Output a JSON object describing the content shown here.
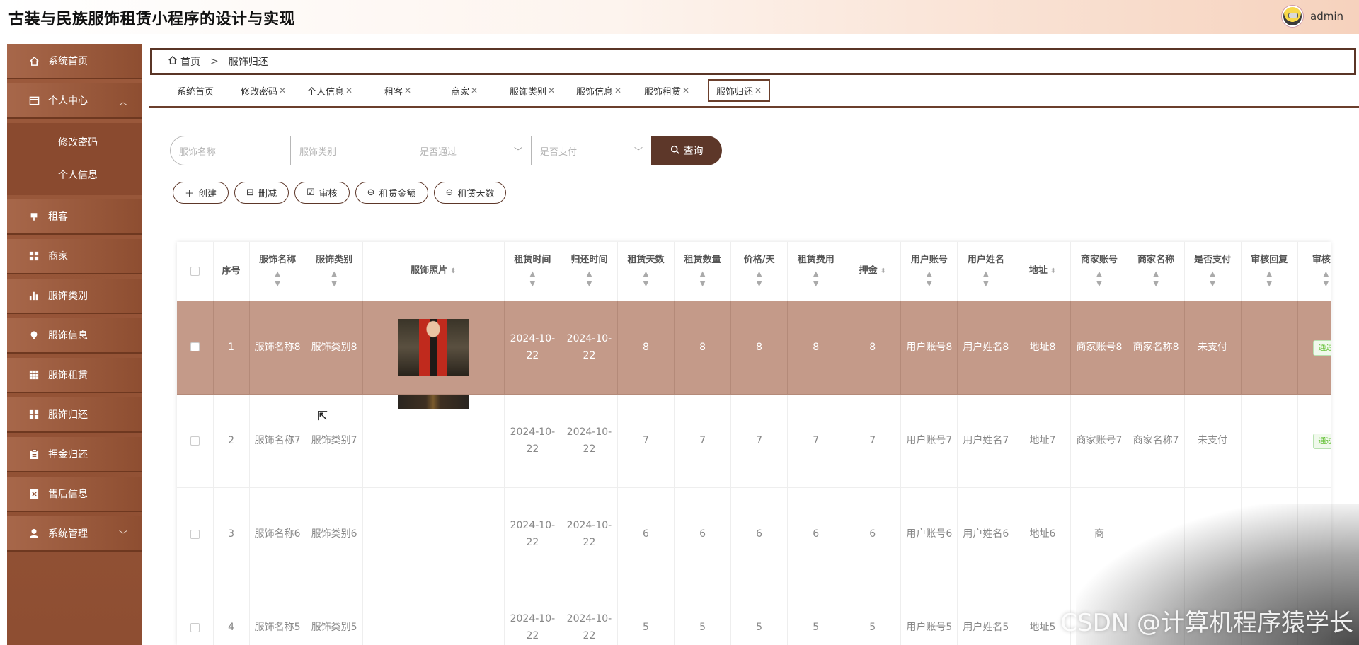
{
  "app": {
    "title": "古装与民族服饰租赁小程序的设计与实现",
    "user": "admin"
  },
  "sidebar": {
    "items": [
      {
        "label": "系统首页",
        "icon": "home-icon"
      },
      {
        "label": "个人中心",
        "icon": "user-card-icon",
        "expanded": true,
        "children": [
          {
            "label": "修改密码"
          },
          {
            "label": "个人信息"
          }
        ]
      },
      {
        "label": "租客",
        "icon": "stamp-icon"
      },
      {
        "label": "商家",
        "icon": "grid-icon"
      },
      {
        "label": "服饰类别",
        "icon": "bar-chart-icon"
      },
      {
        "label": "服饰信息",
        "icon": "bulb-icon"
      },
      {
        "label": "服饰租赁",
        "icon": "table-icon"
      },
      {
        "label": "服饰归还",
        "icon": "grid-icon"
      },
      {
        "label": "押金归还",
        "icon": "clipboard-icon"
      },
      {
        "label": "售后信息",
        "icon": "document-icon"
      },
      {
        "label": "系统管理",
        "icon": "person-icon"
      }
    ]
  },
  "breadcrumb": {
    "home": "首页",
    "separator": ">",
    "current": "服饰归还"
  },
  "tabs": [
    {
      "label": "系统首页",
      "closable": false
    },
    {
      "label": "修改密码",
      "closable": true
    },
    {
      "label": "个人信息",
      "closable": true
    },
    {
      "label": "租客",
      "closable": true
    },
    {
      "label": "商家",
      "closable": true
    },
    {
      "label": "服饰类别",
      "closable": true
    },
    {
      "label": "服饰信息",
      "closable": true
    },
    {
      "label": "服饰租赁",
      "closable": true
    },
    {
      "label": "服饰归还",
      "closable": true,
      "active": true
    }
  ],
  "search": {
    "name_placeholder": "服饰名称",
    "category_placeholder": "服饰类别",
    "passed_placeholder": "是否通过",
    "paid_placeholder": "是否支付",
    "query_label": "查询"
  },
  "actions": {
    "create": "创建",
    "delete": "删减",
    "review": "审核",
    "amount": "租赁金额",
    "days": "租赁天数"
  },
  "table": {
    "headers": {
      "index": "序号",
      "name": "服饰名称",
      "category": "服饰类别",
      "photo": "服饰照片",
      "rent_time": "租赁时间",
      "return_time": "归还时间",
      "rent_days": "租赁天数",
      "rent_qty": "租赁数量",
      "price": "价格/天",
      "rent_fee": "租赁费用",
      "deposit": "押金",
      "user_account": "用户账号",
      "user_name": "用户姓名",
      "address": "地址",
      "merchant_account": "商家账号",
      "merchant_name": "商家名称",
      "paid": "是否支付",
      "review_reply": "审核回复",
      "review_status": "审核状"
    },
    "rows": [
      {
        "index": "1",
        "name": "服饰名称8",
        "category": "服饰类别8",
        "rent_time": "2024-10-22",
        "return_time": "2024-10-22",
        "rent_days": "8",
        "rent_qty": "8",
        "price": "8",
        "rent_fee": "8",
        "deposit": "8",
        "user_account": "用户账号8",
        "user_name": "用户姓名8",
        "address": "地址8",
        "merchant_account": "商家账号8",
        "merchant_name": "商家名称8",
        "paid": "未支付",
        "review_reply": "",
        "review_status": "通过"
      },
      {
        "index": "2",
        "name": "服饰名称7",
        "category": "服饰类别7",
        "rent_time": "2024-10-22",
        "return_time": "2024-10-22",
        "rent_days": "7",
        "rent_qty": "7",
        "price": "7",
        "rent_fee": "7",
        "deposit": "7",
        "user_account": "用户账号7",
        "user_name": "用户姓名7",
        "address": "地址7",
        "merchant_account": "商家账号7",
        "merchant_name": "商家名称7",
        "paid": "未支付",
        "review_reply": "",
        "review_status": "通过"
      },
      {
        "index": "3",
        "name": "服饰名称6",
        "category": "服饰类别6",
        "rent_time": "2024-10-22",
        "return_time": "2024-10-22",
        "rent_days": "6",
        "rent_qty": "6",
        "price": "6",
        "rent_fee": "6",
        "deposit": "6",
        "user_account": "用户账号6",
        "user_name": "用户姓名6",
        "address": "地址6",
        "merchant_account": "商",
        "merchant_name": "",
        "paid": "",
        "review_reply": "",
        "review_status": ""
      },
      {
        "index": "4",
        "name": "服饰名称5",
        "category": "服饰类别5",
        "rent_time": "2024-10-22",
        "return_time": "2024-10-22",
        "rent_days": "5",
        "rent_qty": "5",
        "price": "5",
        "rent_fee": "5",
        "deposit": "5",
        "user_account": "用户账号5",
        "user_name": "用户姓名5",
        "address": "地址5",
        "merchant_account": "",
        "merchant_name": "",
        "paid": "",
        "review_reply": "",
        "review_status": ""
      }
    ]
  },
  "watermark": "CSDN @计算机程序猿学长",
  "colors": {
    "primary": "#5d3729",
    "sidebar": "#9c5a3c",
    "highlight_row": "#c49a89",
    "pass_tag": "#67c23a"
  }
}
